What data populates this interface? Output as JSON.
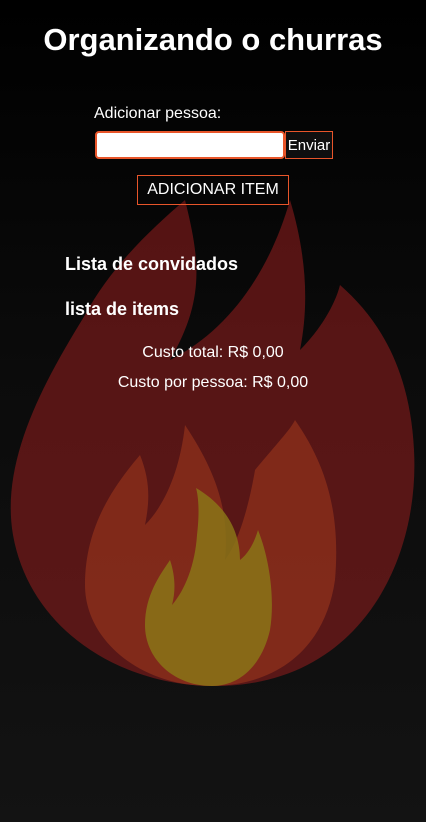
{
  "app": {
    "title": "Organizando o churras"
  },
  "add_person": {
    "label": "Adicionar pessoa:",
    "input_value": "",
    "input_placeholder": "",
    "submit_label": "Enviar"
  },
  "add_item_button_label": "ADICIONAR ITEM",
  "guests": {
    "heading": "Lista de convidados",
    "items": []
  },
  "items": {
    "heading": "lista de items",
    "entries": []
  },
  "costs": {
    "total": "Custo total: R$ 0,00",
    "per_person": "Custo por pessoa: R$ 0,00"
  },
  "colors": {
    "background": "#000000",
    "accent_border": "#e8552a",
    "flame_outer": "#8b1d1d",
    "flame_middle": "#9c3a1e",
    "flame_inner": "#8a7418"
  },
  "icons": {
    "background": "flame-icon"
  }
}
